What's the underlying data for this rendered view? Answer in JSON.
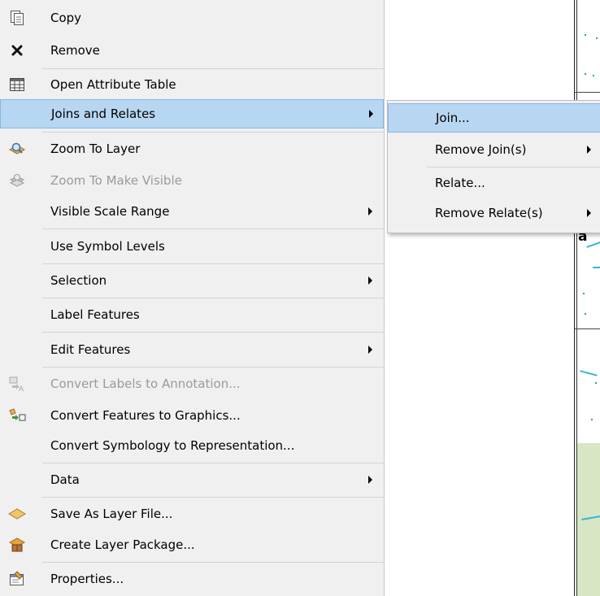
{
  "colors": {
    "highlight": "#b7d6f1",
    "highlight_border": "#87b7e2",
    "menu_bg": "#f0f0f0",
    "disabled_text": "#9a9a9a",
    "map_green": "#d8e6c4",
    "river": "#34b6d8"
  },
  "menu": {
    "items": [
      {
        "label": "Copy",
        "icon": "copy-icon"
      },
      {
        "label": "Remove",
        "icon": "remove-x-icon"
      },
      {
        "label": "Open Attribute Table",
        "icon": "table-icon"
      },
      {
        "label": "Joins and Relates",
        "highlighted": true,
        "submenu": true
      },
      {
        "label": "Zoom To Layer",
        "icon": "zoom-to-layer-icon"
      },
      {
        "label": "Zoom To Make Visible",
        "icon": "zoom-to-make-visible-icon",
        "disabled": true
      },
      {
        "label": "Visible Scale Range",
        "submenu": true
      },
      {
        "label": "Use Symbol Levels"
      },
      {
        "label": "Selection",
        "submenu": true
      },
      {
        "label": "Label Features"
      },
      {
        "label": "Edit Features",
        "submenu": true
      },
      {
        "label": "Convert Labels to Annotation...",
        "icon": "convert-labels-icon",
        "disabled": true
      },
      {
        "label": "Convert Features to Graphics...",
        "icon": "convert-features-icon"
      },
      {
        "label": "Convert Symbology to Representation..."
      },
      {
        "label": "Data",
        "submenu": true
      },
      {
        "label": "Save As Layer File...",
        "icon": "layer-file-icon"
      },
      {
        "label": "Create Layer Package...",
        "icon": "layer-package-icon"
      },
      {
        "label": "Properties...",
        "icon": "properties-icon"
      }
    ]
  },
  "submenu": {
    "items": [
      {
        "label": "Join...",
        "highlighted": true
      },
      {
        "label": "Remove Join(s)",
        "submenu": true
      },
      {
        "label": "Relate..."
      },
      {
        "label": "Remove Relate(s)",
        "submenu": true
      }
    ]
  },
  "map": {
    "label_fragment": "a"
  }
}
